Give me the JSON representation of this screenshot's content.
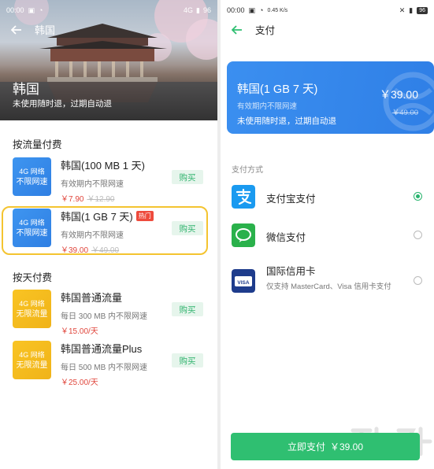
{
  "left": {
    "status": {
      "time": "00:00",
      "signal_text": "4G",
      "battery": "96"
    },
    "nav_title": "韩国",
    "hero": {
      "country": "韩国",
      "subtitle": "未使用随时退，过期自动退"
    },
    "section_traffic": "按流量付费",
    "section_daily": "按天付费",
    "plans": [
      {
        "name": "韩国(100 MB 1 天)",
        "desc": "有效期内不限网速",
        "price": "￥7.90",
        "old_price": "￥12.90",
        "badge_top": "4G 网络",
        "badge_bottom": "不限网速",
        "buy": "购买",
        "hot": ""
      },
      {
        "name": "韩国(1 GB 7 天)",
        "desc": "有效期内不限网速",
        "price": "￥39.00",
        "old_price": "￥49.00",
        "badge_top": "4G 网络",
        "badge_bottom": "不限网速",
        "buy": "购买",
        "hot": "热门"
      },
      {
        "name": "韩国普通流量",
        "desc": "每日 300 MB 内不限网速",
        "price": "￥15.00/天",
        "old_price": "",
        "badge_top": "4G 网络",
        "badge_bottom": "无限流量",
        "buy": "购买",
        "hot": ""
      },
      {
        "name": "韩国普通流量Plus",
        "desc": "每日 500 MB 内不限网速",
        "price": "￥25.00/天",
        "old_price": "",
        "badge_top": "4G 网络",
        "badge_bottom": "无限流量",
        "buy": "购买",
        "hot": ""
      }
    ]
  },
  "right": {
    "status": {
      "time": "00:00",
      "speed": "0.45 K/s",
      "battery": "96"
    },
    "nav_title": "支付",
    "card": {
      "name": "韩国(1 GB 7 天)",
      "desc": "有效期内不限网速",
      "sub": "未使用随时退，过期自动退",
      "price": "￥39.00",
      "old_price": "￥49.00"
    },
    "pay_label": "支付方式",
    "methods": [
      {
        "name": "支付宝支付",
        "desc": "",
        "icon": "alipay-icon",
        "selected": true
      },
      {
        "name": "微信支付",
        "desc": "",
        "icon": "wechat-pay-icon",
        "selected": false
      },
      {
        "name": "国际信用卡",
        "desc": "仅支持 MasterCard、Visa 信用卡支付",
        "icon": "visa-icon",
        "selected": false
      }
    ],
    "pay_button": {
      "label": "立即支付",
      "amount": "￥39.00"
    },
    "colors": {
      "accent": "#2fbf71",
      "blue": "#3b8ff0",
      "price_red": "#e0453b",
      "highlight": "#f4c430"
    }
  }
}
